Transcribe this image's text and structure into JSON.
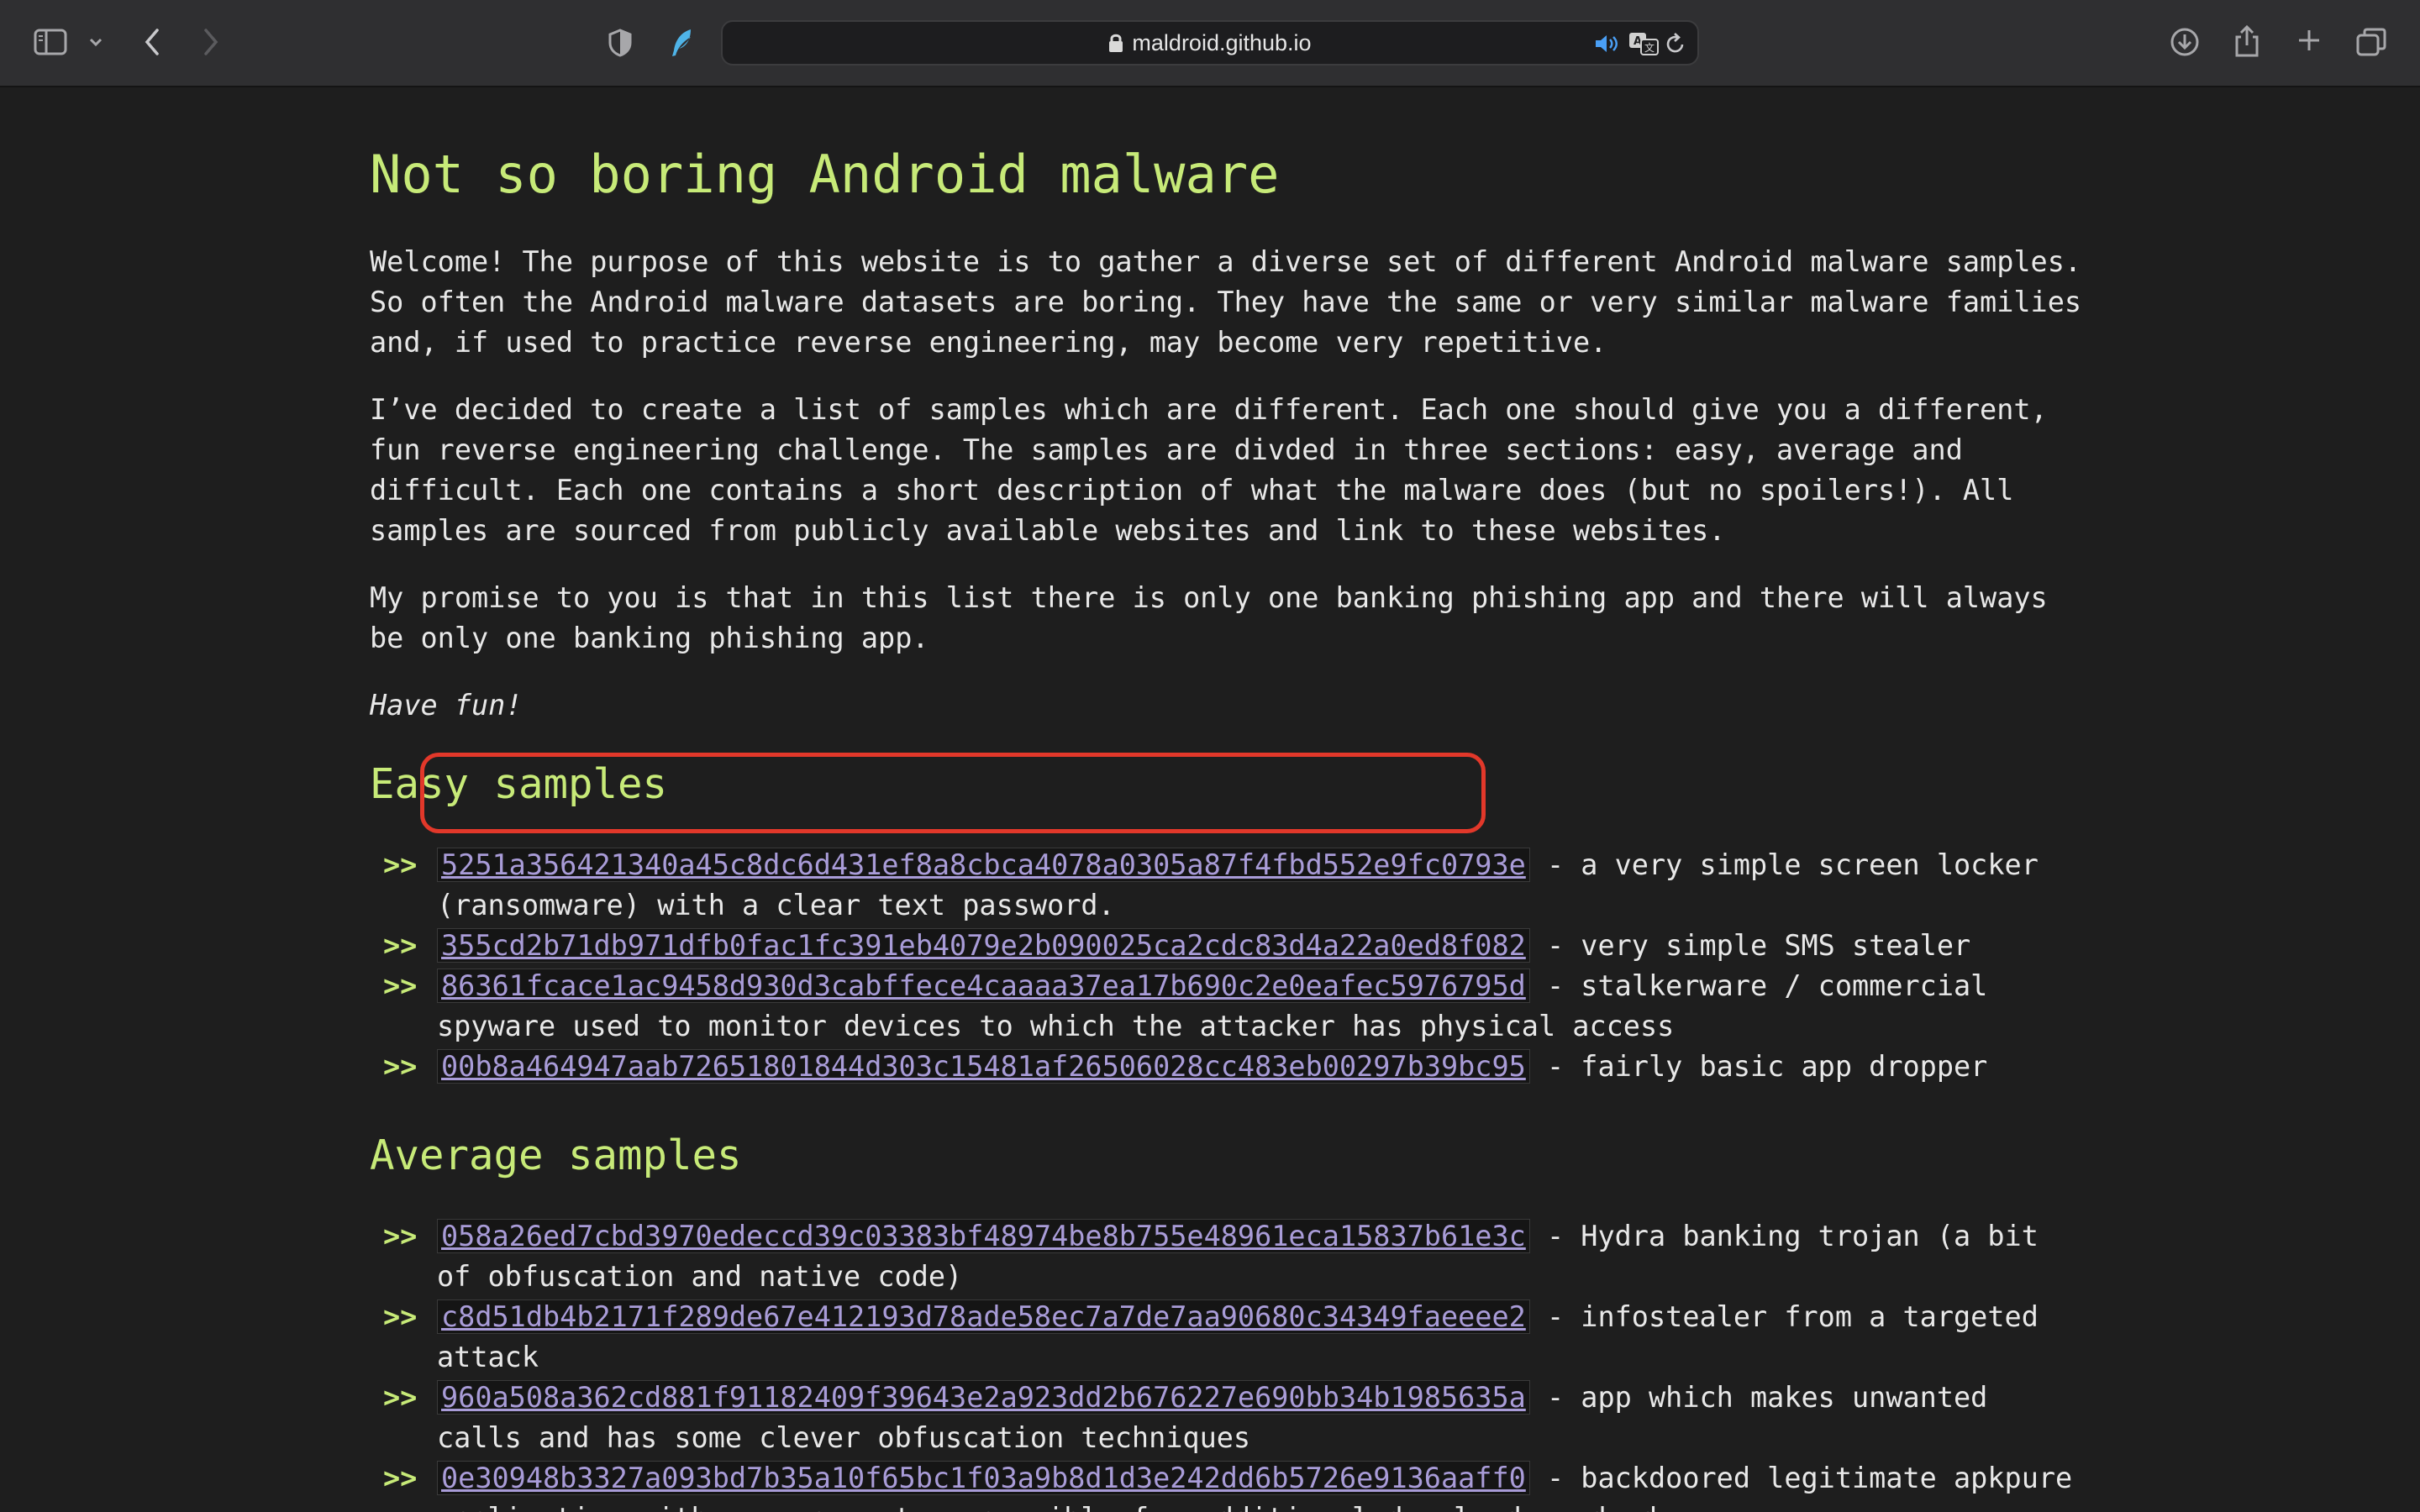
{
  "browser": {
    "url": "maldroid.github.io",
    "icons": {
      "sidebar": "sidebar-icon",
      "dropdown": "chevron-down-icon",
      "back": "back-arrow-icon",
      "forward": "forward-arrow-icon",
      "privacy": "shield-icon",
      "extension": "feather-extension-icon",
      "lock": "lock-icon",
      "audio": "speaker-icon",
      "translate": "translate-icon",
      "reload": "reload-icon",
      "download": "download-icon",
      "share": "share-icon",
      "new_tab": "plus-icon",
      "tabs": "tab-overview-icon"
    }
  },
  "page": {
    "title": "Not so boring Android malware",
    "paragraphs": [
      "Welcome! The purpose of this website is to gather a diverse set of different Android malware samples. So often the Android malware datasets are boring. They have the same or very similar malware families and, if used to practice reverse engineering, may become very repetitive.",
      "I’ve decided to create a list of samples which are different. Each one should give you a different, fun reverse engineering challenge. The samples are divded in three sections: easy, average and difficult. Each one contains a short description of what the malware does (but no spoilers!). All samples are sourced from publicly available websites and link to these websites.",
      "My promise to you is that in this list there is only one banking phishing app and there will always be only one banking phishing app."
    ],
    "closing": "Have fun!",
    "arrow": ">>",
    "easy": {
      "heading": "Easy samples",
      "items": [
        {
          "hash": "5251a356421340a45c8dc6d431ef8a8cbca4078a0305a87f4fbd552e9fc0793e",
          "desc": " - a very simple screen locker (ransomware) with a clear text password."
        },
        {
          "hash": "355cd2b71db971dfb0fac1fc391eb4079e2b090025ca2cdc83d4a22a0ed8f082",
          "desc": " - very simple SMS stealer"
        },
        {
          "hash": "86361fcace1ac9458d930d3cabffece4caaaa37ea17b690c2e0eafec5976795d",
          "desc": " - stalkerware / commercial spyware used to monitor devices to which the attacker has physical access"
        },
        {
          "hash": "00b8a464947aab72651801844d303c15481af26506028cc483eb00297b39bc95",
          "desc": " - fairly basic app dropper"
        }
      ]
    },
    "average": {
      "heading": "Average samples",
      "items": [
        {
          "hash": "058a26ed7cbd3970edeccd39c03383bf48974be8b755e48961eca15837b61e3c",
          "desc": " - Hydra banking trojan (a bit of obfuscation and native code)"
        },
        {
          "hash": "c8d51db4b2171f289de67e412193d78ade58ec7a7de7aa90680c34349faeeee2",
          "desc": " - infostealer from a targeted attack"
        },
        {
          "hash": "960a508a362cd881f91182409f39643e2a923dd2b676227e690bb34b1985635a",
          "desc": " - app which makes unwanted calls and has some clever obfuscation techniques"
        },
        {
          "hash": "0e30948b3327a093bd7b35a10f65bc1f03a9b8d1d3e242dd6b5726e9136aaff0",
          "desc": " - backdoored legitimate apkpure application with a component responsible for additional downloads and adware"
        }
      ]
    }
  },
  "colors": {
    "accent": "#c7ea78",
    "link": "#a99cd8",
    "annotation": "#e2382a",
    "background": "#1e1e1e"
  }
}
